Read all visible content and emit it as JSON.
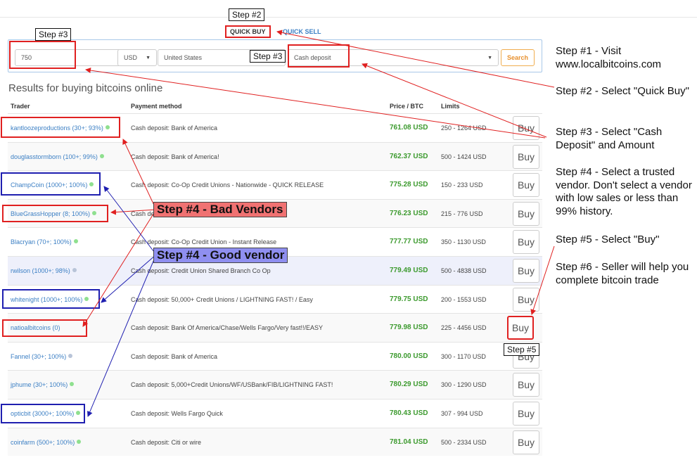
{
  "tabs": {
    "quick_buy": "QUICK BUY",
    "quick_sell": "QUICK SELL"
  },
  "search": {
    "amount": "750",
    "currency": "USD",
    "country": "United States",
    "payment_method": "Cash deposit",
    "button": "Search"
  },
  "results_title": "Results for buying bitcoins online",
  "columns": {
    "trader": "Trader",
    "payment": "Payment method",
    "price": "Price / BTC",
    "limits": "Limits"
  },
  "buy_label": "Buy",
  "rows": [
    {
      "trader": "kantloozeproductions (30+; 93%)",
      "payment": "Cash deposit: Bank of America",
      "price": "761.08 USD",
      "limits": "250 - 1264 USD"
    },
    {
      "trader": "douglasstormborn (100+; 99%)",
      "payment": "Cash deposit: Bank of America!",
      "price": "762.37 USD",
      "limits": "500 - 1424 USD"
    },
    {
      "trader": "ChampCoin (1000+; 100%)",
      "payment": "Cash deposit: Co-Op Credit Unions - Nationwide - QUICK RELEASE",
      "price": "775.28 USD",
      "limits": "150 - 233 USD"
    },
    {
      "trader": "BlueGrassHopper (8; 100%)",
      "payment": "Cash de",
      "price": "776.23 USD",
      "limits": "215 - 776 USD"
    },
    {
      "trader": "Blacryan (70+; 100%)",
      "payment": "Cash deposit: Co-Op Credit Union - Instant Release",
      "price": "777.77 USD",
      "limits": "350 - 1130 USD"
    },
    {
      "trader": "rwilson (1000+; 98%)",
      "payment": "Cash deposit: Credit Union Shared Branch Co Op",
      "price": "779.49 USD",
      "limits": "500 - 4838 USD"
    },
    {
      "trader": "whitenight (1000+; 100%)",
      "payment": "Cash deposit: 50,000+ Credit Unions / LIGHTNING FAST! / Easy",
      "price": "779.75 USD",
      "limits": "200 - 1553 USD"
    },
    {
      "trader": "natioalbitcoins (0)",
      "payment": "Cash deposit: Bank Of America/Chase/Wells Fargo/Very fast!!/EASY",
      "price": "779.98 USD",
      "limits": "225 - 4456 USD"
    },
    {
      "trader": "Fannel (30+; 100%)",
      "payment": "Cash deposit: Bank of America",
      "price": "780.00 USD",
      "limits": "300 - 1170 USD"
    },
    {
      "trader": "jphume (30+; 100%)",
      "payment": "Cash deposit: 5,000+Credit Unions/WF/USBank/FIB/LIGHTNING FAST!",
      "price": "780.29 USD",
      "limits": "300 - 1290 USD"
    },
    {
      "trader": "opticbit (3000+; 100%)",
      "payment": "Cash deposit: Wells Fargo Quick",
      "price": "780.43 USD",
      "limits": "307 - 994 USD"
    },
    {
      "trader": "coinfarm (500+; 100%)",
      "payment": "Cash deposit: Citi or wire",
      "price": "781.04 USD",
      "limits": "500 - 2334 USD"
    }
  ],
  "annotations": {
    "step2_tag": "Step #2",
    "step3_tag": "Step #3",
    "step3b_tag": "Step #3",
    "step5_tag": "Step #5",
    "bad_vendors": "Step #4 - Bad Vendors",
    "good_vendor": "Step #4 - Good vendor",
    "colors": {
      "red": "#e02020",
      "blue": "#1f1fb0",
      "bad_banner": "#f07272",
      "good_banner": "#8f8ff0"
    }
  },
  "instructions": [
    "Step #1 - Visit www.localbitcoins.com",
    "Step #2 - Select \"Quick Buy\"",
    "Step #3 - Select \"Cash Deposit\" and Amount",
    "Step #4 - Select a trusted vendor.  Don't select a vendor with low sales or less than 99% history.",
    "Step #5 - Select \"Buy\"",
    "Step #6 - Seller will help you complete bitcoin trade"
  ]
}
